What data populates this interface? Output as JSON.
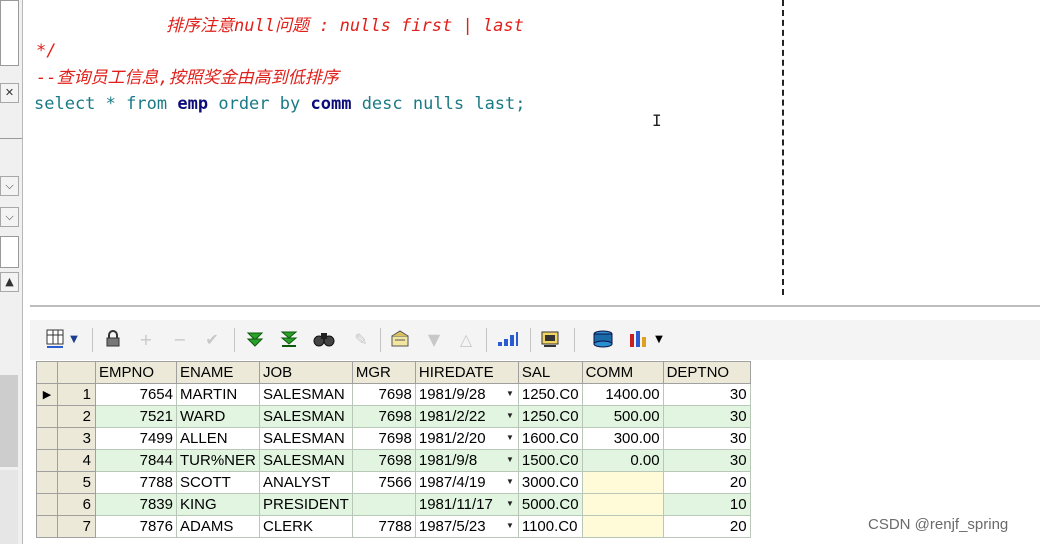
{
  "editor": {
    "line_comment_title": "排序注意null问题 : nulls first | last",
    "line_comment_end": "*/",
    "line_comment_cn": "--查询员工信息,按照奖金由高到低排序",
    "sql": {
      "select": "select",
      "star": "*",
      "from": "from",
      "table": "emp",
      "order_by": "order by",
      "column": "comm",
      "desc": "desc",
      "nulls": "nulls",
      "last": "last",
      "semicolon": ";"
    }
  },
  "gutter": {
    "close_glyph": "✕",
    "chevron_glyph": "⌵"
  },
  "toolbar": {
    "icons": [
      "grid-view-icon",
      "lock-icon",
      "add-icon",
      "remove-icon",
      "post-icon",
      "next-record-icon",
      "last-record-icon",
      "find-icon",
      "clear-icon",
      "query-by-example-icon",
      "filter-icon",
      "clear-filter-icon",
      "chart-bars-icon",
      "export-icon",
      "print-icon",
      "stats-icon"
    ]
  },
  "grid": {
    "columns": [
      "EMPNO",
      "ENAME",
      "JOB",
      "MGR",
      "HIREDATE",
      "SAL",
      "COMM",
      "DEPTNO"
    ],
    "rows": [
      {
        "num": "1",
        "EMPNO": "7654",
        "ENAME": "MARTIN",
        "JOB": "SALESMAN",
        "MGR": "7698",
        "HIREDATE": "1981/9/28",
        "SAL": "1250.C0",
        "COMM": "1400.00",
        "DEPTNO": "30"
      },
      {
        "num": "2",
        "EMPNO": "7521",
        "ENAME": "WARD",
        "JOB": "SALESMAN",
        "MGR": "7698",
        "HIREDATE": "1981/2/22",
        "SAL": "1250.C0",
        "COMM": "500.00",
        "DEPTNO": "30"
      },
      {
        "num": "3",
        "EMPNO": "7499",
        "ENAME": "ALLEN",
        "JOB": "SALESMAN",
        "MGR": "7698",
        "HIREDATE": "1981/2/20",
        "SAL": "1600.C0",
        "COMM": "300.00",
        "DEPTNO": "30"
      },
      {
        "num": "4",
        "EMPNO": "7844",
        "ENAME": "TUR%NER",
        "JOB": "SALESMAN",
        "MGR": "7698",
        "HIREDATE": "1981/9/8",
        "SAL": "1500.C0",
        "COMM": "0.00",
        "DEPTNO": "30"
      },
      {
        "num": "5",
        "EMPNO": "7788",
        "ENAME": "SCOTT",
        "JOB": "ANALYST",
        "MGR": "7566",
        "HIREDATE": "1987/4/19",
        "SAL": "3000.C0",
        "COMM": "",
        "DEPTNO": "20"
      },
      {
        "num": "6",
        "EMPNO": "7839",
        "ENAME": "KING",
        "JOB": "PRESIDENT",
        "MGR": "",
        "HIREDATE": "1981/11/17",
        "SAL": "5000.C0",
        "COMM": "",
        "DEPTNO": "10"
      },
      {
        "num": "7",
        "EMPNO": "7876",
        "ENAME": "ADAMS",
        "JOB": "CLERK",
        "MGR": "7788",
        "HIREDATE": "1987/5/23",
        "SAL": "1100.C0",
        "COMM": "",
        "DEPTNO": "20"
      }
    ]
  },
  "watermark": "CSDN @renjf_spring",
  "colors": {
    "comment": "#e0201a",
    "keyword": "#0c0c7a",
    "plain": "#1a7a86",
    "row_alt": "#e1f5e1",
    "null_cell": "#fffbd9"
  }
}
